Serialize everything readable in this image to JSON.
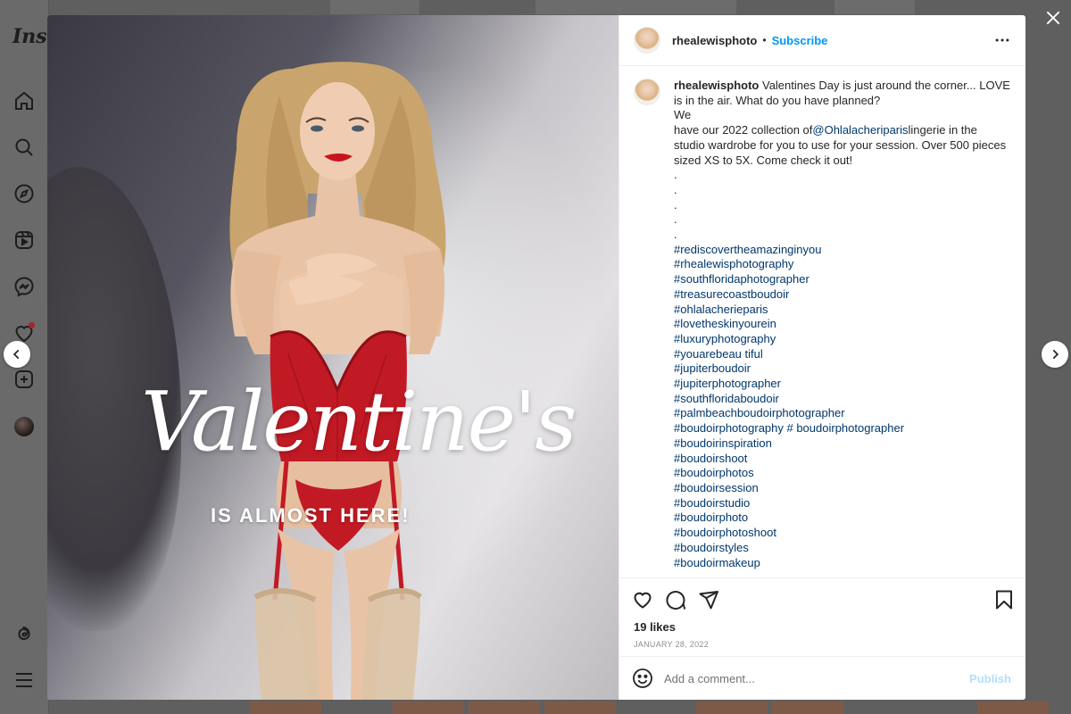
{
  "app": {
    "logo_text": "Inst",
    "nav_icons": [
      "home-icon",
      "search-icon",
      "explore-icon",
      "reels-icon",
      "messenger-icon",
      "notifications-icon",
      "create-icon",
      "profile-avatar",
      "threads-icon",
      "menu-icon"
    ]
  },
  "image": {
    "headline_script": "Valentine's",
    "subheadline": "IS ALMOST HERE!"
  },
  "post": {
    "author": "rhealewisphoto",
    "separator": "•",
    "subscribe_label": "Subscribe",
    "caption": {
      "author": "rhealewisphoto",
      "line1": "Valentines Day is just around the corner... LOVE is in the air. What do you have planned?",
      "line2": "We",
      "line3_before": "have our 2022 collection of",
      "mention": "@Ohlalacheriparis",
      "line3_after": "lingerie in the studio wardrobe for you to use for your session. Over 500 pieces sized XS to 5X. Come check it out!",
      "dots": [
        ".",
        ".",
        ".",
        ".",
        "."
      ],
      "hashtags": [
        "#rediscovertheamazinginyou",
        "#rhealewisphotography",
        "#southfloridaphotographer",
        "#treasurecoastboudoir",
        "#ohlalacherieparis",
        "#lovetheskinyourein",
        "#luxuryphotography",
        "#youarebeau tiful",
        "#jupiterboudoir",
        "#jupiterphotographer",
        "#southfloridaboudoir",
        "#palmbeachboudoirphotographer",
        "#boudoirphotography # boudoirphotographer",
        "#boudoirinspiration",
        "#boudoirshoot",
        "#boudoirphotos",
        "#boudoirsession",
        "#boudoirstudio",
        "#boudoirphoto",
        "#boudoirphotoshoot",
        "#boudoirstyles",
        "#boudoirmakeup"
      ]
    },
    "likes": "19 likes",
    "date": "JANUARY 28, 2022",
    "comment_placeholder": "Add a comment...",
    "publish_label": "Publish"
  },
  "colors": {
    "link": "#00376b",
    "subscribe": "#0095f6",
    "publish_disabled": "#b2dffc",
    "notification_dot": "#a3262e"
  }
}
